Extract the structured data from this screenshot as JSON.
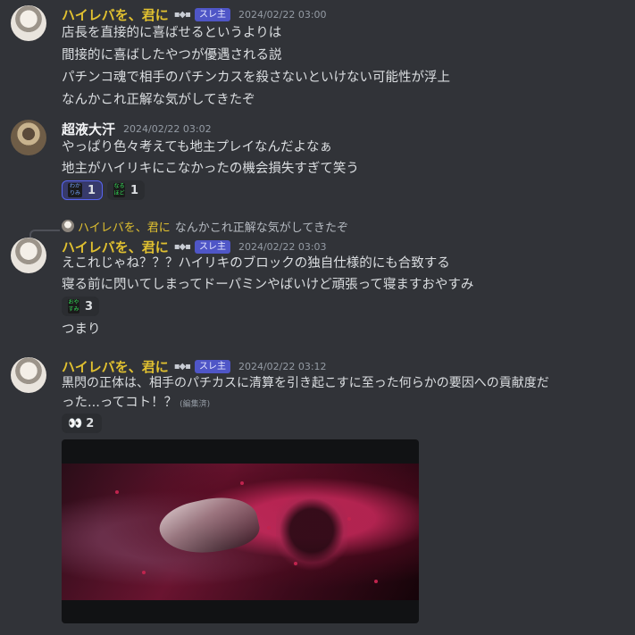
{
  "messages": [
    {
      "author": "ハイレバを、君に",
      "deco": "▪◆▪",
      "badge": "スレ主",
      "timestamp": "2024/02/22 03:00",
      "lines": [
        "店長を直接的に喜ばせるというよりは",
        "間接的に喜ばしたやつが優遇される説",
        "パチンコ魂で相手のパチンカスを殺さないといけない可能性が浮上",
        "なんかこれ正解な気がしてきたぞ"
      ]
    },
    {
      "author": "超液大汗",
      "timestamp": "2024/02/22 03:02",
      "lines": [
        "やっぱり色々考えても地主プレイなんだよなぁ",
        "地主がハイリキにこなかったの機会損失すぎて笑う"
      ],
      "reactions": [
        {
          "emoji_text": "わか りみ",
          "count": "1"
        },
        {
          "emoji_text": "なる ほど",
          "count": "1"
        }
      ]
    },
    {
      "reply": {
        "author": "ハイレバを、君に",
        "text": "なんかこれ正解な気がしてきたぞ"
      },
      "author": "ハイレバを、君に",
      "deco": "▪◆▪",
      "badge": "スレ主",
      "timestamp": "2024/02/22 03:03",
      "lines": [
        "えこれじゃね？？？ハイリキのブロックの独自仕様的にも合致する",
        "寝る前に閃いてしまってドーパミンやばいけど頑張って寝ますおやすみ"
      ],
      "reactions": [
        {
          "emoji_text": "おや すみ",
          "count": "3"
        }
      ],
      "followup": "つまり"
    },
    {
      "author": "ハイレバを、君に",
      "deco": "▪◆▪",
      "badge": "スレ主",
      "timestamp": "2024/02/22 03:12",
      "lines": [
        "黒閃の正体は、相手のパチカスに清算を引き起こすに至った何らかの要因への貢献度だ",
        "った...ってコト！？"
      ],
      "edited": "(編集済)",
      "reactions": [
        {
          "emoji_text": "👀",
          "count": "2"
        }
      ]
    }
  ]
}
